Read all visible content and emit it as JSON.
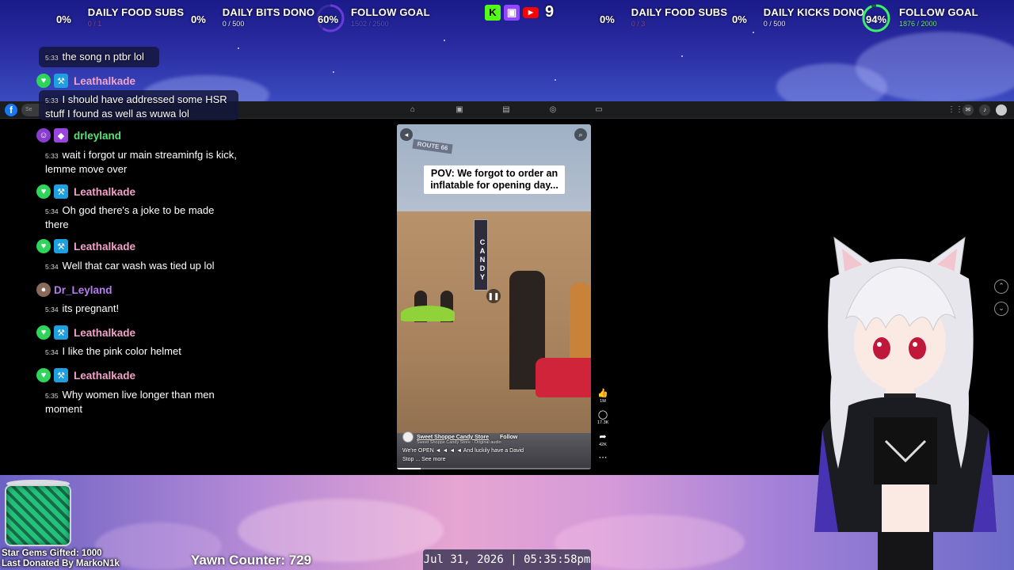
{
  "goals_left": [
    {
      "pct": "0%",
      "title": "DAILY FOOD SUBS",
      "sub": "0 / 1",
      "sub_style": "red"
    },
    {
      "pct": "0%",
      "title": "DAILY BITS DONO",
      "sub": "0 / 500",
      "sub_style": "plain"
    },
    {
      "pct": "60%",
      "title": "FOLLOW GOAL",
      "sub": "1502 / 2500",
      "sub_style": "faint"
    }
  ],
  "goals_right": [
    {
      "pct": "0%",
      "title": "DAILY FOOD SUBS",
      "sub": "0 / 3",
      "sub_style": "red"
    },
    {
      "pct": "0%",
      "title": "DAILY KICKS DONO",
      "sub": "0 / 500",
      "sub_style": "plain"
    },
    {
      "pct": "94%",
      "title": "FOLLOW GOAL",
      "sub": "1876 / 2000",
      "sub_style": "green"
    }
  ],
  "platforms": {
    "viewer_count": "9",
    "icons": [
      "kick-icon",
      "twitch-icon",
      "youtube-icon"
    ]
  },
  "chat": [
    {
      "user": "",
      "time": "5:33",
      "text": "the song n ptbr lol"
    },
    {
      "user": "Leathalkade",
      "time": "5:33",
      "text": "I should have addressed some HSR stuff I found as well as wuwa lol"
    },
    {
      "user": "drleyland",
      "time": "5:33",
      "text": "wait i forgot ur main streaminfg is kick, lemme move over"
    },
    {
      "user": "Leathalkade",
      "time": "5:34",
      "text": "Oh god there's a joke to be made there"
    },
    {
      "user": "Leathalkade",
      "time": "5:34",
      "text": "Well that car wash was tied up lol"
    },
    {
      "user": "Dr_Leyland",
      "time": "5:34",
      "text": "its pregnant!"
    },
    {
      "user": "Leathalkade",
      "time": "5:34",
      "text": "I like the pink color helmet"
    },
    {
      "user": "Leathalkade",
      "time": "5:35",
      "text": "Why women live longer than men moment"
    }
  ],
  "colors": {
    "leathalkade": "#f2a3c9",
    "drleyland": "#5ce07a",
    "dr_leyland": "#b77cf0",
    "accent_green": "#2fd45a"
  },
  "browser": {
    "search_placeholder": "Se"
  },
  "reel": {
    "caption": "POV: We forgot to order an inflatable for opening day...",
    "sign": "CANDY",
    "route": "ROUTE 66",
    "store_name": "Sweet Shoppe Candy Store",
    "follow": "Follow",
    "audio": "Sweet Shoppe Candy Store · Original audio",
    "description": "We're OPEN ◄ ◄ ◄ ◄ And luckily have a David",
    "description_2": "Stop ... See more",
    "likes": "1M",
    "comments": "17.3K",
    "shares": "42K"
  },
  "bottom": {
    "gems_line1": "Star Gems Gifted: 1000",
    "gems_line2": "Last Donated By MarkoN1k",
    "yawn": "Yawn Counter: 729",
    "clock": "Jul 31, 2026 | 05:35:58pm"
  }
}
